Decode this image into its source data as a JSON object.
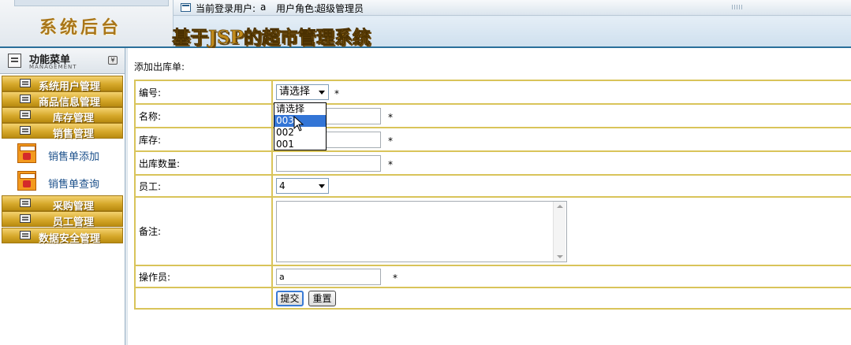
{
  "header": {
    "brand": "系统后台",
    "login_label": "当前登录用户:",
    "login_user": "a",
    "role_label": "用户角色:",
    "role_value": "超级管理员",
    "system_title": "基于JSP的超市管理系统"
  },
  "sidebar": {
    "menu_title": "功能菜单",
    "menu_subtitle": "MANAGEMENT",
    "groups": [
      {
        "label": "系统用户管理"
      },
      {
        "label": "商品信息管理"
      },
      {
        "label": "库存管理"
      },
      {
        "label": "销售管理"
      },
      {
        "label": "采购管理"
      },
      {
        "label": "员工管理"
      },
      {
        "label": "数据安全管理"
      }
    ],
    "sub_items": [
      {
        "label": "销售单添加"
      },
      {
        "label": "销售单查询"
      }
    ]
  },
  "main": {
    "heading": "添加出库单:",
    "fields": {
      "code": {
        "label": "编号:",
        "value": "请选择",
        "required": "*"
      },
      "name": {
        "label": "名称:",
        "value": "",
        "required": "*"
      },
      "stock": {
        "label": "库存:",
        "value": "",
        "required": "*"
      },
      "quantity": {
        "label": "出库数量:",
        "value": "",
        "required": "*"
      },
      "employee": {
        "label": "员工:",
        "value": "4"
      },
      "remark": {
        "label": "备注:",
        "value": ""
      },
      "operator": {
        "label": "操作员:",
        "value": "a",
        "required": "*"
      }
    },
    "buttons": {
      "submit": "提交",
      "reset": "重置"
    },
    "dropdown_options": [
      "请选择",
      "003",
      "002",
      "001"
    ],
    "dropdown_highlighted": "003"
  },
  "colors": {
    "menu_bar_gold": "#d6a82a",
    "table_border": "#d9c45a",
    "header_border": "#2a6f9a",
    "option_highlight": "#3375d6",
    "sub_item_text": "#1a4f8a"
  }
}
